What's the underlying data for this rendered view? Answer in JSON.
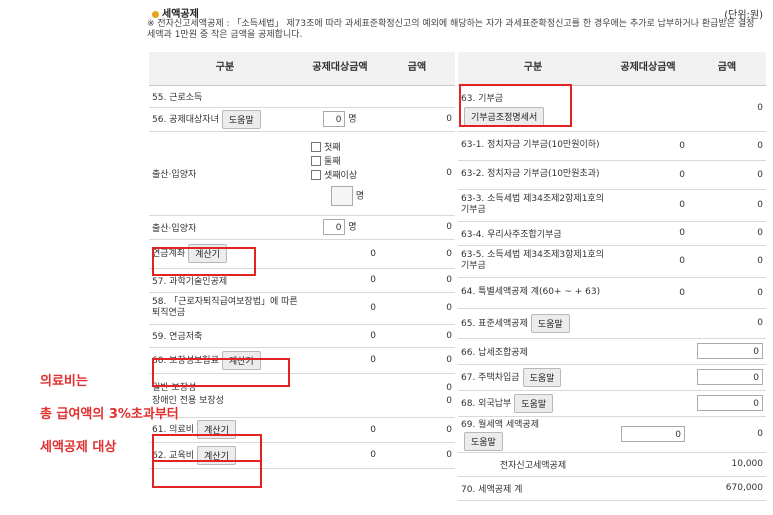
{
  "header": {
    "title": "세액공제",
    "unit": "(단위:원)",
    "note": "※ 전자신고세액공제 : 「소득세법」 제73조에 따라 과세표준확정신고의 예외에 해당하는 자가 과세표준확정신고를 한 경우에는 추가로 납부하거나 환급받은 결정세액과 1만원 중 작은 금액을 공제합니다."
  },
  "columns": {
    "gubun": "구분",
    "base": "공제대상금액",
    "amount": "금액"
  },
  "left": {
    "r55": "55. 근로소득",
    "r56": "56. 공제대상자녀",
    "r56_val": "0",
    "r56_unit": "명",
    "r56_amt": "0",
    "birth": "출산·입양자",
    "birth_opts": [
      "첫째",
      "둘째",
      "셋째이상"
    ],
    "birth_unit": "명",
    "birth_amt": "0",
    "birth2": "출산·입양자",
    "birth2_val": "0",
    "birth2_unit": "명",
    "birth2_amt": "0",
    "pension": "연금계좌",
    "pension_base": "0",
    "pension_amt": "0",
    "r57": "57. 과학기술인공제",
    "r57_base": "0",
    "r57_amt": "0",
    "r58": "58. 「근로자퇴직급여보장법」에 따른 퇴직연금",
    "r58_base": "0",
    "r58_amt": "0",
    "r59": "59. 연금저축",
    "r59_base": "0",
    "r59_amt": "0",
    "r60": "60. 보장성보험료",
    "r60_base": "0",
    "r60_amt": "0",
    "general": "일반 보장성",
    "disabled": "장애인 전용 보장성",
    "general_amt": "0",
    "disabled_amt": "0",
    "r61": "61. 의료비",
    "r61_base": "0",
    "r61_amt": "0",
    "r62": "62. 교육비",
    "r62_base": "0",
    "r62_amt": "0"
  },
  "right": {
    "r63": "63. 기부금",
    "r63_amt": "0",
    "r63_btn": "기부금조정명세서",
    "r63_1": "63-1. 정치자금 기부금(10만원이하)",
    "r63_1_base": "0",
    "r63_1_amt": "0",
    "r63_2": "63-2. 정치자금 기부금(10만원초과)",
    "r63_2_base": "0",
    "r63_2_amt": "0",
    "r63_3": "63-3. 소득세법 제34조제2항제1호의 기부금",
    "r63_3_base": "0",
    "r63_3_amt": "0",
    "r63_4": "63-4. 우리사주조합기부금",
    "r63_4_base": "0",
    "r63_4_amt": "0",
    "r63_5": "63-5. 소득세법 제34조제3항제1호의 기부금",
    "r63_5_base": "0",
    "r63_5_amt": "0",
    "r64": "64. 특별세액공제 계(60+ ~ + 63)",
    "r64_base": "0",
    "r64_amt": "0",
    "r65": "65. 표준세액공제",
    "r65_amt": "0",
    "r66": "66. 납세조합공제",
    "r66_amt": "0",
    "r67": "67. 주택차입금",
    "r67_amt": "0",
    "r68": "68. 외국납부",
    "r68_amt": "0",
    "r69": "69. 월세액 세액공제",
    "r69_base": "0",
    "r69_amt": "0",
    "e_filing": "전자신고세액공제",
    "e_filing_amt": "10,000",
    "r70": "70. 세액공제 계",
    "r70_amt": "670,000"
  },
  "buttons": {
    "help": "도움말",
    "calc": "계산기"
  },
  "annotation": {
    "line1": "의료비는",
    "line2": "총 급여액의 3%초과부터",
    "line3": "세액공제 대상"
  }
}
